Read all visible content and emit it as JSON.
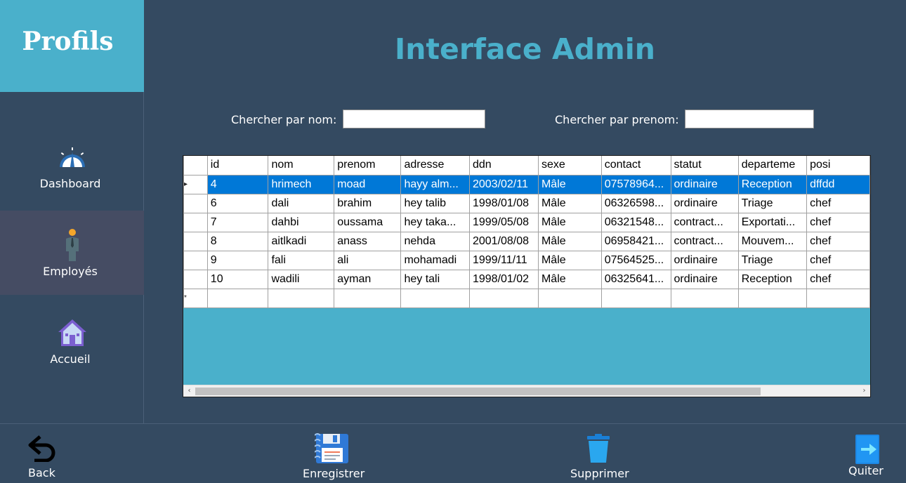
{
  "sidebar": {
    "title": "Profils",
    "items": [
      {
        "label": "Dashboard",
        "icon": "speedometer-icon"
      },
      {
        "label": "Employés",
        "icon": "employee-icon"
      },
      {
        "label": "Accueil",
        "icon": "home-icon"
      }
    ],
    "active_index": 1
  },
  "page_title": "Interface Admin",
  "search": {
    "nom_label": "Chercher par nom:",
    "nom_value": "",
    "prenom_label": "Chercher par prenom:",
    "prenom_value": ""
  },
  "grid": {
    "columns": [
      "id",
      "nom",
      "prenom",
      "adresse",
      "ddn",
      "sexe",
      "contact",
      "statut",
      "departeme",
      "posi"
    ],
    "rows": [
      [
        "4",
        "hrimech",
        "moad",
        "hayy alm...",
        "2003/02/11",
        "Mâle",
        "07578964...",
        "ordinaire",
        "Reception",
        "dffdd"
      ],
      [
        "6",
        "dali",
        "brahim",
        "hey talib",
        "1998/01/08",
        "Mâle",
        "06326598...",
        "ordinaire",
        "Triage",
        "chef"
      ],
      [
        "7",
        "dahbi",
        "oussama",
        "hey taka...",
        "1999/05/08",
        "Mâle",
        "06321548...",
        "contract...",
        "Exportati...",
        "chef"
      ],
      [
        "8",
        "aitlkadi",
        "anass",
        "nehda",
        "2001/08/08",
        "Mâle",
        "06958421...",
        "contract...",
        "Mouvem...",
        "chef"
      ],
      [
        "9",
        "fali",
        "ali",
        "mohamadi",
        "1999/11/11",
        "Mâle",
        "07564525...",
        "ordinaire",
        "Triage",
        "chef"
      ],
      [
        "10",
        "wadili",
        "ayman",
        "hey tali",
        "1998/01/02",
        "Mâle",
        "06325641...",
        "ordinaire",
        "Reception",
        "chef"
      ]
    ],
    "selected_row": 0,
    "current_row_marker": "▸",
    "new_row_marker": "*",
    "scroll_left": "‹",
    "scroll_right": "›"
  },
  "toolbar": {
    "back_label": "Back",
    "save_label": "Enregistrer",
    "delete_label": "Supprimer",
    "quit_label": "Quiter"
  },
  "colors": {
    "background": "#344a61",
    "accent": "#4ab0cb",
    "selection": "#0078d7",
    "active_nav": "#454c63"
  }
}
